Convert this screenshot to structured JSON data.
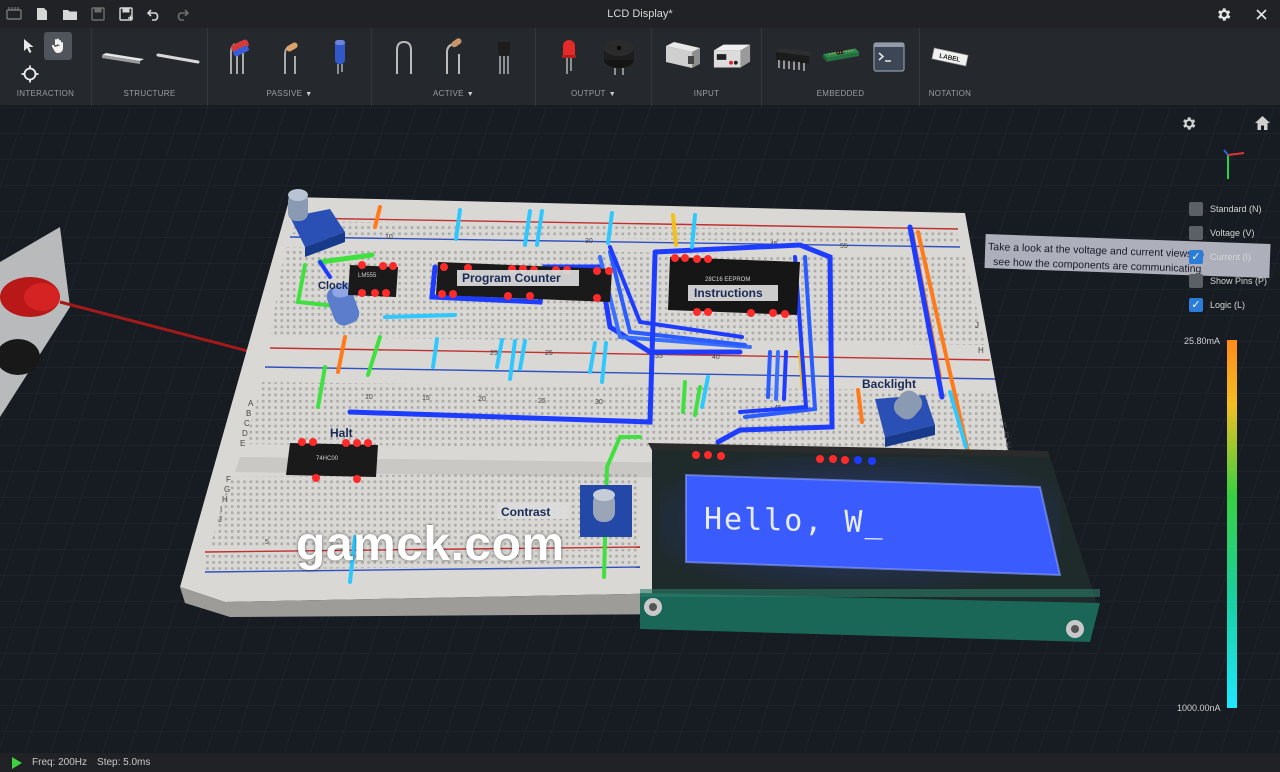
{
  "window": {
    "title": "LCD Display*",
    "left_icons": [
      "app-logo-icon",
      "new-file-icon",
      "open-folder-icon",
      "save-icon",
      "save-as-icon",
      "undo-icon",
      "redo-icon"
    ],
    "right_icons": [
      "settings-icon",
      "close-icon"
    ]
  },
  "toolbar": {
    "groups": [
      {
        "label": "INTERACTION",
        "tools": [
          "pointer-select-tool",
          "hand-pan-tool",
          "crosshair-probe-tool"
        ]
      },
      {
        "label": "STRUCTURE",
        "tools": [
          "breadboard-tool",
          "wire-tool"
        ]
      },
      {
        "label": "PASSIVE",
        "has_dropdown": true,
        "tools": [
          "resistor-pack-tool",
          "resistor-tool",
          "capacitor-tool"
        ]
      },
      {
        "label": "ACTIVE",
        "has_dropdown": true,
        "tools": [
          "diode-tool",
          "transistor-tool",
          "transistor-to92-tool"
        ]
      },
      {
        "label": "OUTPUT",
        "has_dropdown": true,
        "tools": [
          "led-tool",
          "buzzer-tool"
        ]
      },
      {
        "label": "INPUT",
        "tools": [
          "switch-tool",
          "power-supply-tool"
        ]
      },
      {
        "label": "EMBEDDED",
        "tools": [
          "ic-chip-tool",
          "microcontroller-tool",
          "terminal-tool"
        ]
      },
      {
        "label": "NOTATION",
        "tools": [
          "label-tool"
        ]
      }
    ],
    "label_tag_text": "LABEL"
  },
  "viewport": {
    "board_labels": {
      "program_counter": "Program Counter",
      "instructions": "Instructions",
      "backlight": "Backlight",
      "halt": "Halt",
      "contrast": "Contrast",
      "clock": "Clock"
    },
    "chip_labels": {
      "timer": "LM555",
      "eeprom": "28C16 EEPROM",
      "halt_chip": "74HC00"
    },
    "lcd_text": "Hello, W_",
    "hint_text_line1": "Take a look at the voltage and current views to",
    "hint_text_line2": "see how the components are communicating",
    "column_numbers": [
      "5",
      "10",
      "15",
      "20",
      "25",
      "30",
      "35",
      "40",
      "45",
      "50",
      "55"
    ],
    "row_letters": [
      "A",
      "B",
      "C",
      "D",
      "E",
      "F",
      "G",
      "H",
      "I",
      "J"
    ],
    "layers": [
      {
        "label": "Standard (N)",
        "checked": false
      },
      {
        "label": "Voltage (V)",
        "checked": false
      },
      {
        "label": "Current (I)",
        "checked": true
      },
      {
        "label": "Show Pins (P)",
        "checked": false
      },
      {
        "label": "Logic (L)",
        "checked": true
      }
    ],
    "legend": {
      "max": "25.80mA",
      "min": "1000.00nA"
    },
    "watermark": "gamck.com"
  },
  "status": {
    "freq": "Freq: 200Hz",
    "step": "Step: 5.0ms"
  },
  "colors": {
    "accent": "#2b7dd9",
    "wire_blue": "#1e3cff",
    "wire_cyan": "#2ec8ff",
    "wire_orange": "#ff7a1a",
    "wire_green": "#3fe03f",
    "led_red": "#ff2a2a",
    "lcd_blue": "#3a5cff"
  }
}
